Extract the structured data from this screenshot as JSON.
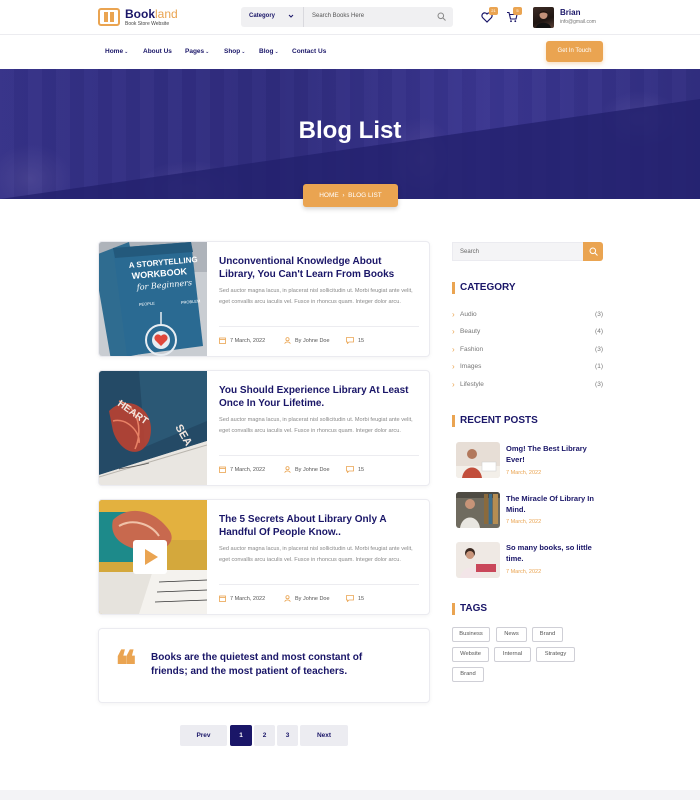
{
  "brand": {
    "name_main": "Book",
    "name_accent": "land",
    "tagline": "Book Store Website"
  },
  "header": {
    "category_label": "Category",
    "search_placeholder": "Search Books Here",
    "wishlist_count": "21",
    "cart_count": "5",
    "user_name": "Brian",
    "user_email": "info@gmail.com"
  },
  "nav": {
    "items": [
      {
        "label": "Home",
        "has_dropdown": true
      },
      {
        "label": "About Us",
        "has_dropdown": false
      },
      {
        "label": "Pages",
        "has_dropdown": true
      },
      {
        "label": "Shop",
        "has_dropdown": true
      },
      {
        "label": "Blog",
        "has_dropdown": true
      },
      {
        "label": "Contact Us",
        "has_dropdown": false
      }
    ],
    "cta_label": "Get In Touch"
  },
  "hero": {
    "title": "Blog List",
    "breadcrumb_home": "HOME",
    "breadcrumb_sep": "›",
    "breadcrumb_current": "BLOG LIST"
  },
  "posts": [
    {
      "title": "Unconventional Knowledge About Library, You Can't Learn From Books",
      "excerpt": "Sed auctor magna lacus, in placerat nisl sollicitudin ut. Morbi feugiat ante velit, eget convallis arcu iaculis vel. Fusce in rhoncus quam. Integer dolor arcu.",
      "date": "7 March, 2022",
      "author": "By Johne Doe",
      "comments": "15",
      "thumb_text_1": "A STORYTELLING",
      "thumb_text_2": "WORKBOOK",
      "thumb_text_3": "for Beginners",
      "thumb_text_4": "PEOPLE",
      "thumb_text_5": "PROBLEM"
    },
    {
      "title": "You Should Experience Library At Least Once In Your Lifetime.",
      "excerpt": "Sed auctor magna lacus, in placerat nisl sollicitudin ut. Morbi feugiat ante velit, eget convallis arcu iaculis vel. Fusce in rhoncus quam. Integer dolor arcu.",
      "date": "7 March, 2022",
      "author": "By Johne Doe",
      "comments": "15",
      "thumb_text_1": "HEART",
      "thumb_text_2": "SEA"
    },
    {
      "title": "The 5 Secrets About Library Only A Handful Of People Know..",
      "excerpt": "Sed auctor magna lacus, in placerat nisl sollicitudin ut. Morbi feugiat ante velit, eget convallis arcu iaculis vel. Fusce in rhoncus quam. Integer dolor arcu.",
      "date": "7 March, 2022",
      "author": "By Johne Doe",
      "comments": "15"
    }
  ],
  "quote": {
    "mark": "❝",
    "text": "Books are the quietest and most constant of friends; and the most patient of teachers."
  },
  "pagination": {
    "prev": "Prev",
    "pages": [
      "1",
      "2",
      "3"
    ],
    "active_page": "1",
    "next": "Next"
  },
  "sidebar": {
    "search_placeholder": "Search",
    "category_title": "CATEGORY",
    "categories": [
      {
        "label": "Audio",
        "count": "(3)"
      },
      {
        "label": "Beauty",
        "count": "(4)"
      },
      {
        "label": "Fashion",
        "count": "(3)"
      },
      {
        "label": "Images",
        "count": "(1)"
      },
      {
        "label": "Lifestyle",
        "count": "(3)"
      }
    ],
    "recent_title": "RECENT POSTS",
    "recent": [
      {
        "title": "Omg! The Best Library Ever!",
        "date": "7 March, 2022"
      },
      {
        "title": "The Miracle Of Library In Mind.",
        "date": "7 March, 2022"
      },
      {
        "title": "So many books, so little time.",
        "date": "7 March, 2022"
      }
    ],
    "tags_title": "TAGS",
    "tags": [
      "Business",
      "News",
      "Brand",
      "Website",
      "Internal",
      "Strategy",
      "Brand"
    ]
  },
  "colors": {
    "primary": "#1a1668",
    "accent": "#eaa451",
    "hero_overlay": "#2c2a7a"
  }
}
